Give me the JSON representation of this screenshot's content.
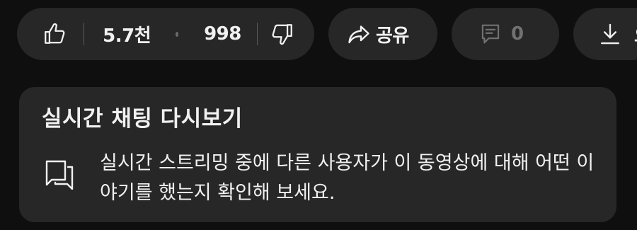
{
  "actions": {
    "like_count": "5.7천",
    "dislike_count": "998",
    "share_label": "공유",
    "comment_count": "0",
    "download_label": "오"
  },
  "live_chat": {
    "title": "실시간 채팅 다시보기",
    "description": "실시간 스트리밍 중에 다른 사용자가 이 동영상에 대해 어떤 이야기를 했는지 확인해 보세요."
  },
  "icons": {
    "like": "thumbs-up-icon",
    "dislike": "thumbs-down-icon",
    "share": "share-arrow-icon",
    "comment": "comment-icon",
    "download": "download-icon",
    "chat": "chat-bubbles-icon"
  }
}
